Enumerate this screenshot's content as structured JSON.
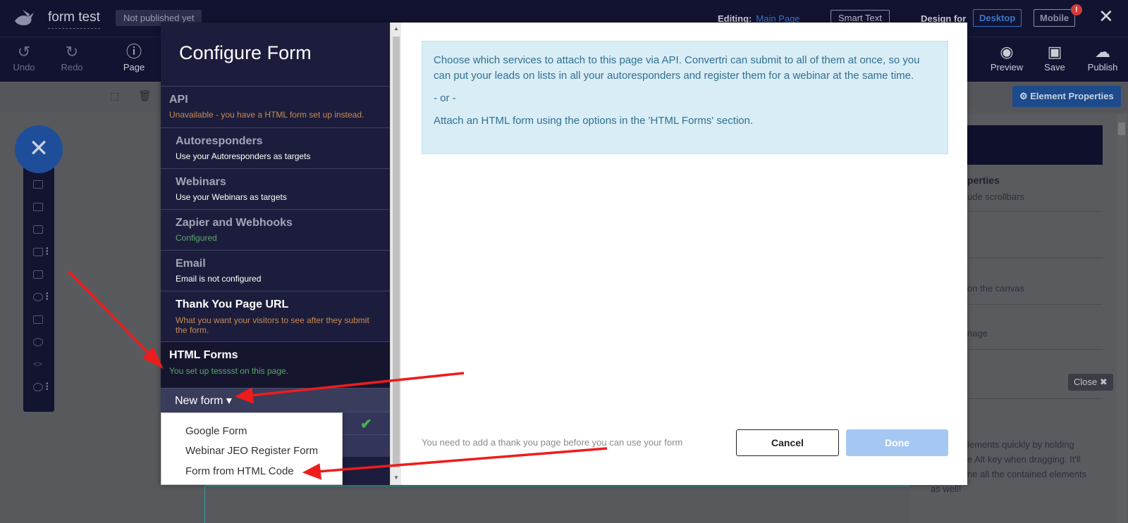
{
  "app": {
    "title": "form test",
    "publish_status": "Not published yet",
    "editing_label": "Editing:",
    "editing_page": "Main Page",
    "smart_text": "Smart Text",
    "design_for_label": "Design for",
    "desktop": "Desktop",
    "mobile": "Mobile",
    "mobile_alert": "!",
    "close_glyph": "✕"
  },
  "toolbar": {
    "undo": "Undo",
    "redo": "Redo",
    "page": "Page",
    "preview": "Preview",
    "save": "Save",
    "publish": "Publish",
    "element_properties": "⚙ Element Properties"
  },
  "right_panel": {
    "heading_fragment": "perties",
    "sub_fragment": "ude scrollbars",
    "canvas_fragment": "on the canvas",
    "image_fragment": "nage",
    "close_pill": "Close ✖",
    "tip_lines": [
      "lements quickly by holding",
      "e Alt key when dragging. It'll",
      "ne all the contained elements",
      "as well!"
    ]
  },
  "modal": {
    "title": "Configure Form",
    "sections": [
      {
        "key": "api",
        "title": "API",
        "subtitle": "Unavailable - you have a HTML form set up instead."
      },
      {
        "key": "autoresponders",
        "title": "Autoresponders",
        "subtitle": "Use your Autoresponders as targets"
      },
      {
        "key": "webinars",
        "title": "Webinars",
        "subtitle": "Use your Webinars as targets"
      },
      {
        "key": "zapier",
        "title": "Zapier and Webhooks",
        "subtitle": "Configured"
      },
      {
        "key": "email",
        "title": "Email",
        "subtitle": "Email is not configured"
      },
      {
        "key": "thankyou",
        "title": "Thank You Page URL",
        "subtitle": "What you want your visitors to see after they submit the form."
      },
      {
        "key": "htmlforms",
        "title": "HTML Forms",
        "subtitle": "You set up tesssst on this page."
      }
    ],
    "new_form_label": "New form ▾",
    "dropdown_items": [
      "Google Form",
      "Webinar JEO Register Form",
      "Form from HTML Code"
    ],
    "info": {
      "p1": "Choose which services to attach to this page via API. Convertri can submit to all of them at once, so you can put your leads on lists in all your autoresponders and register them for a webinar at the same time.",
      "p2": "- or -",
      "p3": "Attach an HTML form using the options in the 'HTML Forms' section."
    },
    "footer_note": "You need to add a thank you page before you can use your form",
    "cancel": "Cancel",
    "done": "Done"
  },
  "colors": {
    "app_bg": "#121330",
    "modal_sidebar": "#1c1d3c",
    "accent_blue": "#3a74c9",
    "info_bg": "#d9edf7",
    "info_text": "#31708f",
    "done_disabled": "#a5c8f3",
    "annotation_arrow": "#ee1c1c"
  }
}
